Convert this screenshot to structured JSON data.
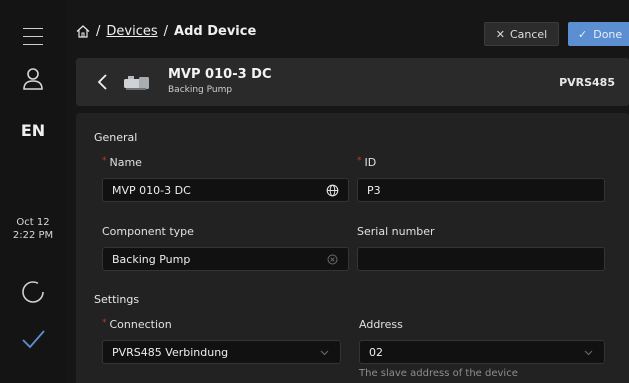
{
  "breadcrumb": {
    "home_icon": "home-icon",
    "separator": "/",
    "devices": "Devices",
    "current": "Add Device"
  },
  "actions": {
    "cancel_label": "Cancel",
    "done_label": "Done",
    "accent": "#5b8fd1"
  },
  "rail": {
    "language": "EN",
    "date": "Oct 12",
    "time": "2:22 PM"
  },
  "device": {
    "name": "MVP 010-3 DC",
    "type": "Backing Pump",
    "protocol": "PVRS485"
  },
  "form": {
    "general_title": "General",
    "name_label": "Name",
    "name_value": "MVP 010-3 DC",
    "id_label": "ID",
    "id_value": "P3",
    "component_type_label": "Component type",
    "component_type_value": "Backing Pump",
    "serial_label": "Serial number",
    "serial_value": "",
    "settings_title": "Settings",
    "connection_label": "Connection",
    "connection_value": "PVRS485 Verbindung",
    "address_label": "Address",
    "address_value": "02",
    "address_hint": "The slave address of the device",
    "required_marker": "*",
    "required_color": "#c0392b"
  }
}
